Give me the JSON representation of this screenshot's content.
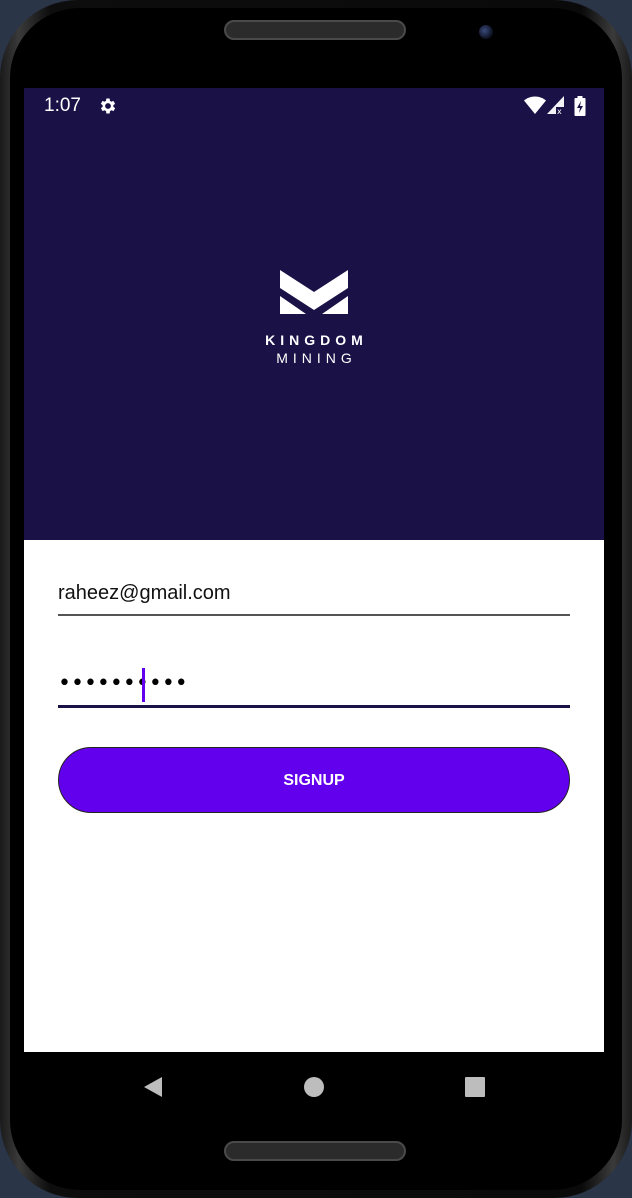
{
  "status_bar": {
    "time": "1:07",
    "icons": [
      "settings-icon",
      "wifi-icon",
      "cell-signal-icon",
      "battery-charging-icon"
    ]
  },
  "logo": {
    "line1": "KINGDOM",
    "line2": "MINING"
  },
  "form": {
    "email_value": "raheez@gmail.com",
    "password_masked": "••••••••••",
    "signup_label": "SIGNUP"
  },
  "nav_bar": {
    "icons": [
      "back-icon",
      "home-icon",
      "recents-icon"
    ]
  },
  "colors": {
    "header_bg": "#1a1247",
    "accent": "#6200ee",
    "screen_bg": "#ffffff"
  }
}
